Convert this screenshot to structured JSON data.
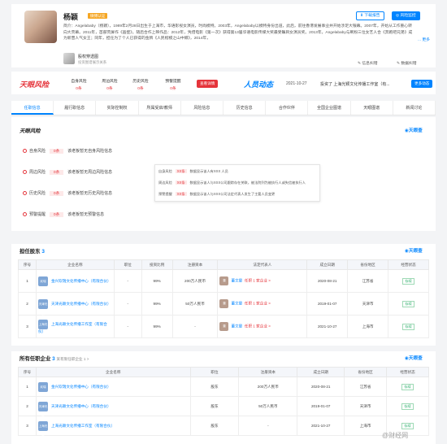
{
  "header": {
    "name": "杨颖",
    "vip": "微博认证",
    "bio": "简介：Angelababy（杨颖），1989年2月28日出生于上海市，华语影视女演员，时尚模特。2003年，Angelababy以模特身份出道，此后，前往香港发展事业并开始涉足大银幕。2007年，开始从工作重心转向大荧幕。2011年，首部荧屏作《画壁》。随后合作上映作品：2012年，凭借电影《第一次》获得第13届华语电影传媒大奖最受瞩目女演员奖。2013年，Angelababy与刷粉三位女艺人合《奔跑吧兄弟》成为新晋人气女王；同年，担任为了个人已获得的金牌《人民楷模之山中鲸》，2014年，",
    "more": "... 更多",
    "btn_download": "下载报告",
    "btn_monitor": "风险监控",
    "sub_name": "股权穿透图",
    "sub_desc": "投资图谱展示关系",
    "link_info": "信息纠错",
    "link_data": "数据纠错"
  },
  "riskbar": {
    "logo": "天眼风险",
    "stats": [
      {
        "label": "自身风险",
        "value": "0条"
      },
      {
        "label": "周边风险",
        "value": "0条"
      },
      {
        "label": "历史风险",
        "value": "0条"
      },
      {
        "label": "预警提醒",
        "value": "0条"
      }
    ],
    "btn": "查看详情",
    "dyn_logo": "人员动态",
    "dyn_date": "2021-10-27",
    "dyn_text": "投资了 上海光颖文化传播工作室（有...",
    "dyn_btn": "更多动态"
  },
  "tabs": [
    "任职信息",
    "履行职信息",
    "实际控制权",
    "所属受启/教师",
    "风险信息",
    "历史信息",
    "合作伙伴",
    "全国企业图谱",
    "天眼图谱",
    "新闻讨论"
  ],
  "risk": {
    "title": "天眼风险",
    "tyc": "天眼查",
    "rows": [
      {
        "label": "自身风险",
        "count": "0条",
        "desc": "该老板暂无自身风险信息"
      },
      {
        "label": "周边风险",
        "count": "0条",
        "desc": "该老板暂无周边风险信息"
      },
      {
        "label": "历史风险",
        "count": "0条",
        "desc": "该老板暂无历史风险信息"
      },
      {
        "label": "预警提醒",
        "count": "0条",
        "desc": "该老板暂无预警信息"
      }
    ],
    "popup": [
      {
        "label": "自身风险",
        "count": "XX条",
        "desc": "数据显示该人有XXX 人员"
      },
      {
        "label": "周边风险",
        "count": "XX条",
        "desc": "数据显示该人与XXX公司跟踪存在关联，被法院列为被执行人或失信被执行人"
      },
      {
        "label": "预警提醒",
        "count": "XX条",
        "desc": "数据显示该人与XXX公司法定代表人发生了主要人员变更"
      }
    ]
  },
  "table1": {
    "title": "担任股东",
    "count": "3",
    "tyc": "天眼查",
    "headers": [
      "序号",
      "企业名称",
      "职位",
      "投资比例",
      "注册资本",
      "法定代表人",
      "成立日期",
      "省份地区",
      "经营状态"
    ],
    "rows": [
      {
        "no": "1",
        "ico": "欢瑞",
        "name": "金兴欢瑞文化传播中心（有限合伙）",
        "pos": "-",
        "ratio": "99%",
        "cap": "200万人民币",
        "rep": "董文晏",
        "rep_link": "任职 1 家企业 >",
        "date": "2020-08-21",
        "prov": "江苏省",
        "status": "存续"
      },
      {
        "no": "2",
        "ico": "天津光颖",
        "name": "天津光颖文化传播中心（有限合伙）",
        "pos": "-",
        "ratio": "99%",
        "cap": "50万人民币",
        "rep": "董文晏",
        "rep_link": "任职 1 家企业 >",
        "date": "2019-01-07",
        "prov": "天津市",
        "status": "存续"
      },
      {
        "no": "3",
        "ico": "上海光颖",
        "name": "上海光颖文化传播工作室（有限合伙）",
        "pos": "-",
        "ratio": "99%",
        "cap": "-",
        "rep": "董文晏",
        "rep_link": "任职 1 家企业 >",
        "date": "2021-10-27",
        "prov": "上海市",
        "status": "存续"
      }
    ]
  },
  "table2": {
    "title": "所有任职企业",
    "count": "3",
    "sub": "某有限任职企业 1 >",
    "tyc": "天眼查",
    "headers": [
      "序号",
      "企业名称",
      "职位",
      "注册资本",
      "成立日期",
      "省份地区",
      "经营状态"
    ],
    "rows": [
      {
        "no": "1",
        "ico": "欢瑞",
        "name": "金兴欢瑞文化传播中心（有限合伙）",
        "pos": "股东",
        "cap": "200万人民币",
        "date": "2020-08-21",
        "prov": "江苏省",
        "status": "存续"
      },
      {
        "no": "2",
        "ico": "天津光颖",
        "name": "天津光颖文化传播中心（有限合伙）",
        "pos": "股东",
        "cap": "50万人民币",
        "date": "2019-01-07",
        "prov": "天津市",
        "status": "存续"
      },
      {
        "no": "3",
        "ico": "上海光颖",
        "name": "上海光颖文化传播工作室（有限合伙）",
        "pos": "股东",
        "cap": "-",
        "date": "2021-10-27",
        "prov": "上海市",
        "status": "存续"
      }
    ]
  },
  "watermark": "@财经网"
}
